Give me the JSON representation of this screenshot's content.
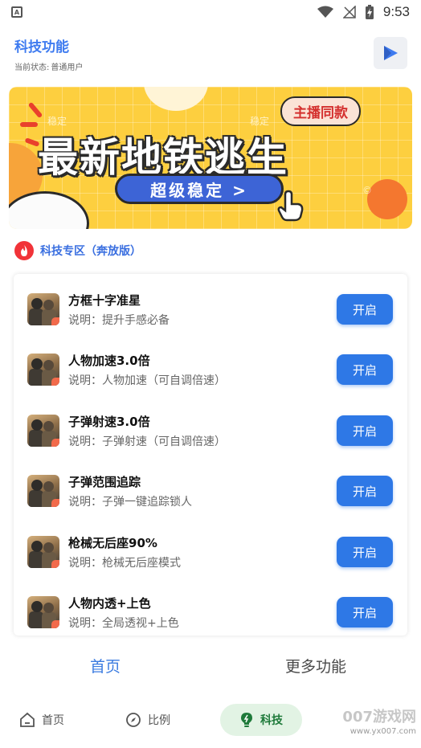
{
  "status_bar": {
    "time": "9:53"
  },
  "header": {
    "title": "科技功能",
    "status_label": "当前状态:",
    "status_value": "普通用户"
  },
  "banner": {
    "badge": "主播同款",
    "headline": "最新地铁逃生",
    "pill": "超级稳定 >",
    "watermarks": [
      "稳定",
      "稳定",
      "©"
    ]
  },
  "section": {
    "title": "科技专区（奔放版）"
  },
  "features": [
    {
      "title": "方框十字准星",
      "desc_label": "说明：",
      "desc": "提升手感必备",
      "button": "开启"
    },
    {
      "title": "人物加速3.0倍",
      "desc_label": "说明：",
      "desc": "人物加速（可自调倍速）",
      "button": "开启"
    },
    {
      "title": "子弹射速3.0倍",
      "desc_label": "说明：",
      "desc": "子弹射速（可自调倍速）",
      "button": "开启"
    },
    {
      "title": "子弹范围追踪",
      "desc_label": "说明：",
      "desc": "子弹一键追踪锁人",
      "button": "开启"
    },
    {
      "title": "枪械无后座90%",
      "desc_label": "说明：",
      "desc": "枪械无后座模式",
      "button": "开启"
    },
    {
      "title": "人物内透+上色",
      "desc_label": "说明：",
      "desc": "全局透视+上色",
      "button": "开启"
    }
  ],
  "tabs": [
    {
      "label": "首页",
      "active": true
    },
    {
      "label": "更多功能",
      "active": false
    }
  ],
  "bottom_nav": [
    {
      "label": "首页",
      "icon": "home-icon"
    },
    {
      "label": "比例",
      "icon": "compass-icon"
    },
    {
      "label": "科技",
      "icon": "bulb-icon",
      "active": true
    }
  ],
  "watermark": {
    "site": "007游戏网",
    "url": "www.yx007.com"
  },
  "colors": {
    "accent": "#2e78e6",
    "nav_active_bg": "#e2f3e4",
    "banner_bg": "#fdcf3f"
  }
}
